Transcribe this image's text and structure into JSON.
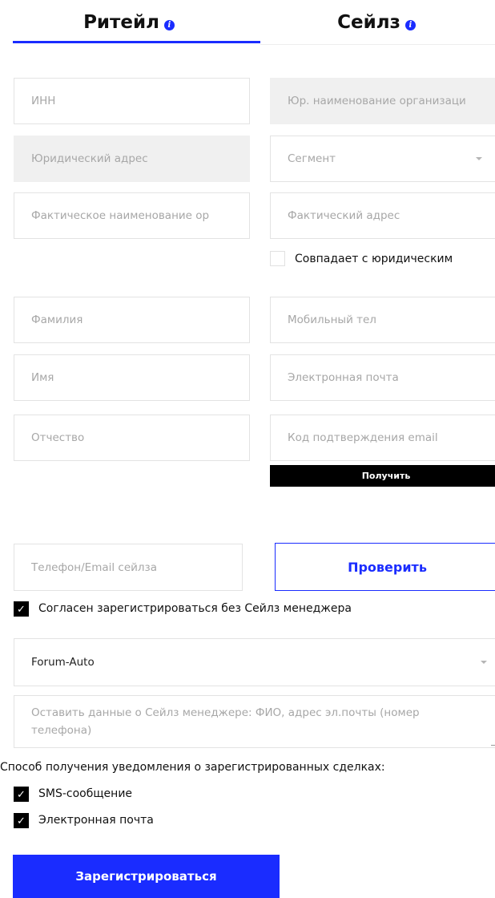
{
  "tabs": {
    "retail": "Ритейл",
    "sales": "Сейлз",
    "info_icon": "i"
  },
  "form": {
    "inn": "ИНН",
    "legal_name": "Юр. наименование организаци",
    "legal_address": "Юридический адрес",
    "segment": "Сегмент",
    "actual_name": "Фактическое наименование ор",
    "actual_address": "Фактический адрес",
    "same_as_legal": "Совпадает с юридическим",
    "last_name": "Фамилия",
    "mobile_phone": "Мобильный тел",
    "first_name": "Имя",
    "email": "Электронная почта",
    "patronymic": "Отчество",
    "email_code": "Код подтверждения email",
    "get_button": "Получить",
    "sales_contact": "Телефон/Email сейлза",
    "verify_button": "Проверить",
    "agree_without_manager": "Согласен зарегистрироваться без Сейлз менеджера",
    "dealer_select_value": "Forum-Auto",
    "manager_info_placeholder": "Оставить данные о Сейлз менеджере: ФИО, адрес эл.почты (номер телефона)",
    "notification_title": "Способ получения уведомления о зарегистрированных сделках:",
    "notify_sms": "SMS-сообщение",
    "notify_email": "Электронная почта",
    "submit_button": "Зарегистрироваться"
  },
  "checkboxes": {
    "same_as_legal": false,
    "agree_without_manager": true,
    "notify_sms": true,
    "notify_email": true
  },
  "check_glyph": "✓",
  "colors": {
    "accent": "#1a2cff",
    "input_border": "#e3e3e3",
    "disabled_bg": "#f0f0f0",
    "placeholder": "#a7a7a7"
  }
}
